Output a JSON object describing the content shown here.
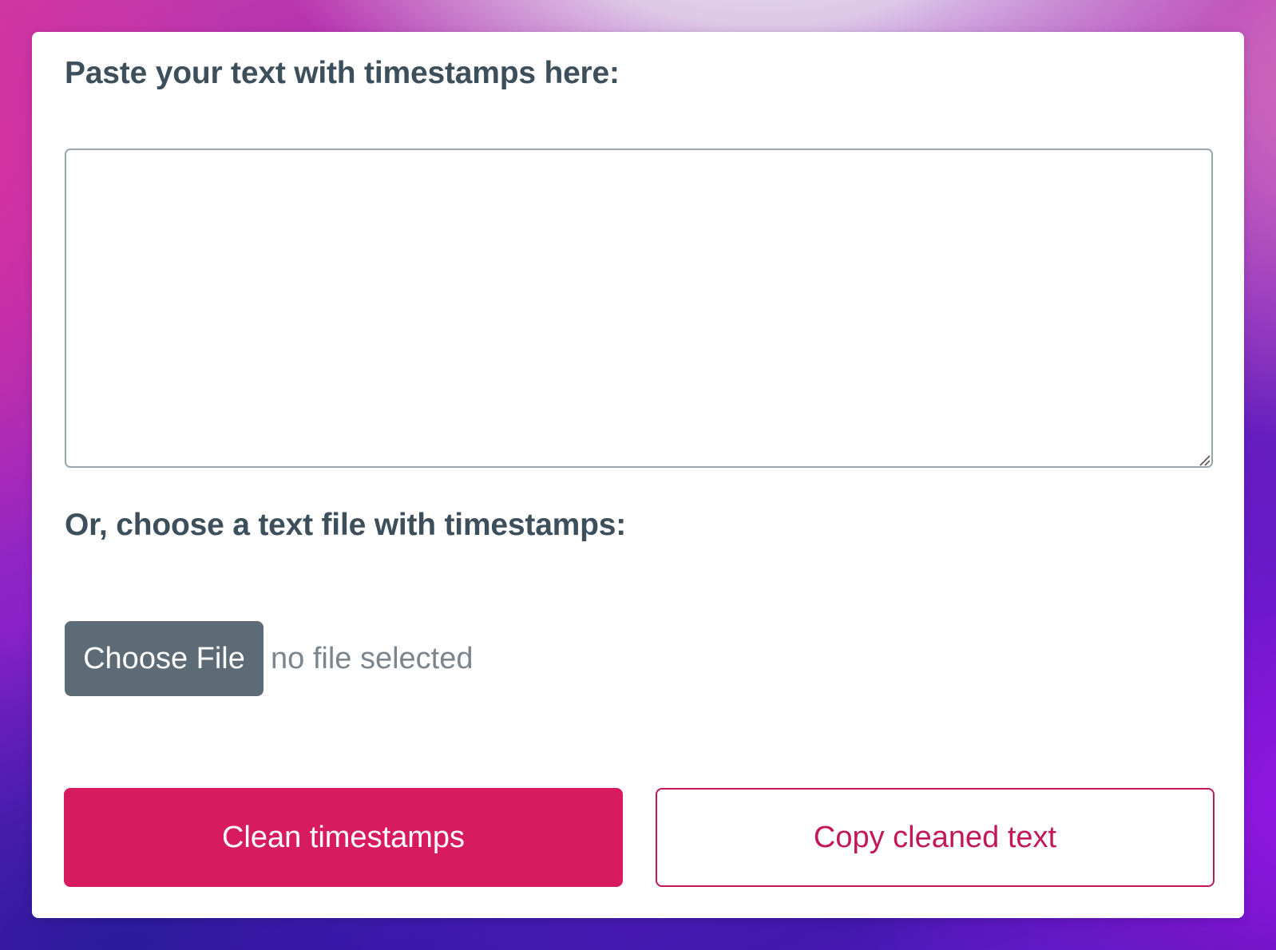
{
  "form": {
    "paste_label": "Paste your text with timestamps here:",
    "textarea_value": "",
    "file_label": "Or, choose a text file with timestamps:",
    "choose_file_label": "Choose File",
    "file_status": "no file selected",
    "clean_button_label": "Clean timestamps",
    "copy_button_label": "Copy cleaned text"
  },
  "colors": {
    "primary": "#d81b5e",
    "outline_accent": "#c2185b",
    "label_text": "#3d4f5b",
    "file_button_bg": "#5c6b75",
    "muted_text": "#7a858d"
  },
  "icons": {
    "resize_grip": "resize-grip-icon"
  }
}
